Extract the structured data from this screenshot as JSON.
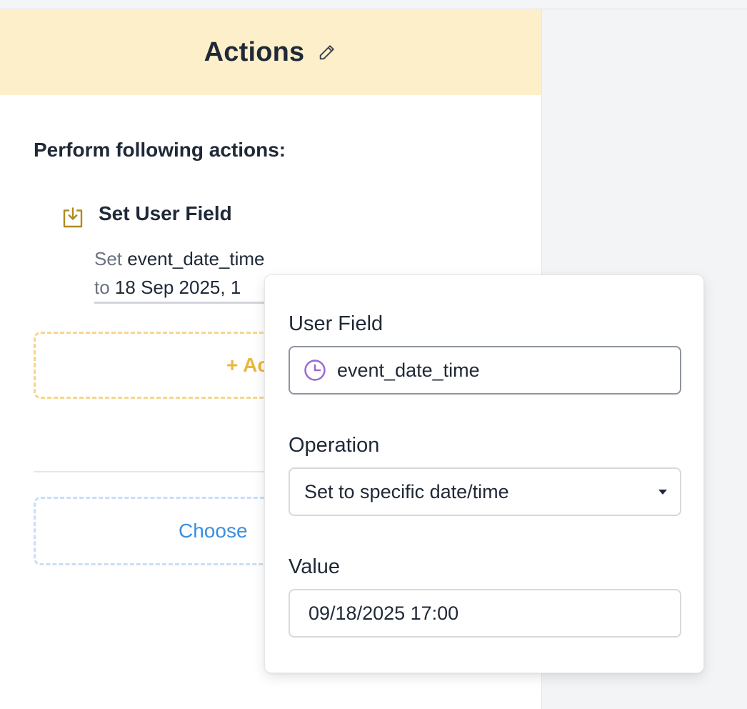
{
  "panel": {
    "title": "Actions",
    "section_heading": "Perform following actions:",
    "action": {
      "title": "Set User Field",
      "summary_set_prefix": "Set",
      "summary_field": "event_date_time",
      "summary_to_prefix": "to",
      "summary_value": "18 Sep 2025, 1"
    },
    "add_action_label": "+ Ac",
    "choose_label": "Choose"
  },
  "popover": {
    "user_field_label": "User Field",
    "user_field_value": "event_date_time",
    "operation_label": "Operation",
    "operation_value": "Set to specific date/time",
    "value_label": "Value",
    "value_value": "09/18/2025 17:00"
  },
  "icons": {
    "edit": "pencil-icon",
    "action": "download-tray-icon",
    "field_type": "clock-icon",
    "dropdown": "caret-down-icon"
  },
  "colors": {
    "header_bg": "#fdefc9",
    "add_border": "#f7d58a",
    "add_text": "#eab73b",
    "choose_border": "#c9def7",
    "choose_text": "#3b8fe0",
    "action_icon": "#b08a20",
    "clock": "#9b6ad6"
  }
}
